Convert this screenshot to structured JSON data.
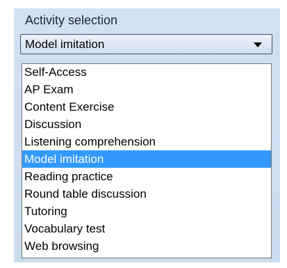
{
  "panel": {
    "title": "Activity selection"
  },
  "combo": {
    "value": "Model imitation",
    "arrow_icon": "chevron-down-icon"
  },
  "list": {
    "selected_index": 5,
    "items": [
      "Self-Access",
      "AP Exam",
      "Content Exercise",
      "Discussion",
      "Listening comprehension",
      "Model imitation",
      "Reading practice",
      "Round table discussion",
      "Tutoring",
      "Vocabulary test",
      "Web browsing"
    ]
  },
  "colors": {
    "panel_bg": "#cfdeef",
    "selection_bg": "#3399ff",
    "selection_text": "#ffffff"
  }
}
